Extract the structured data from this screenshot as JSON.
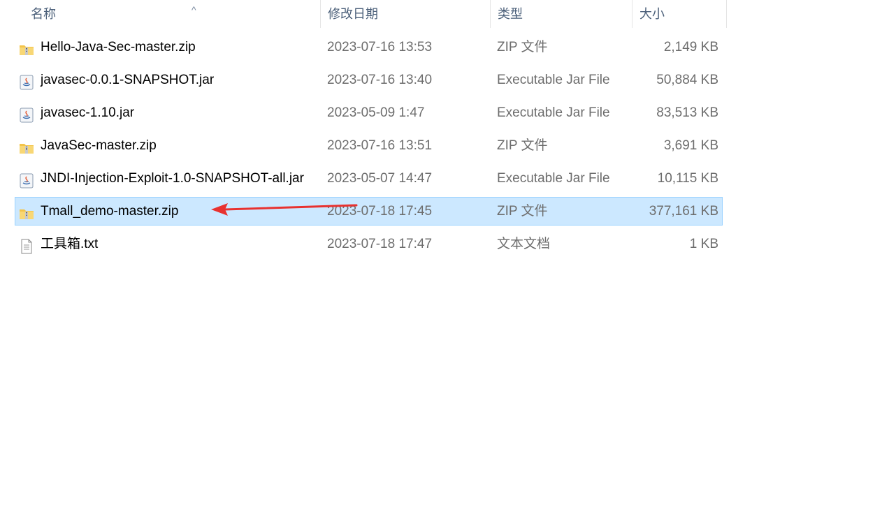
{
  "header": {
    "name_label": "名称",
    "date_label": "修改日期",
    "type_label": "类型",
    "size_label": "大小",
    "sort_indicator": "^"
  },
  "files": [
    {
      "name": "Hello-Java-Sec-master.zip",
      "date": "2023-07-16 13:53",
      "type": "ZIP 文件",
      "size": "2,149 KB",
      "icon": "zip-folder-icon",
      "selected": false
    },
    {
      "name": "javasec-0.0.1-SNAPSHOT.jar",
      "date": "2023-07-16 13:40",
      "type": "Executable Jar File",
      "size": "50,884 KB",
      "icon": "java-jar-icon",
      "selected": false
    },
    {
      "name": "javasec-1.10.jar",
      "date": "2023-05-09 1:47",
      "type": "Executable Jar File",
      "size": "83,513 KB",
      "icon": "java-jar-icon",
      "selected": false
    },
    {
      "name": "JavaSec-master.zip",
      "date": "2023-07-16 13:51",
      "type": "ZIP 文件",
      "size": "3,691 KB",
      "icon": "zip-folder-icon",
      "selected": false
    },
    {
      "name": "JNDI-Injection-Exploit-1.0-SNAPSHOT-all.jar",
      "date": "2023-05-07 14:47",
      "type": "Executable Jar File",
      "size": "10,115 KB",
      "icon": "java-jar-icon",
      "selected": false
    },
    {
      "name": "Tmall_demo-master.zip",
      "date": "2023-07-18 17:45",
      "type": "ZIP 文件",
      "size": "377,161 KB",
      "icon": "zip-folder-icon",
      "selected": true
    },
    {
      "name": "工具箱.txt",
      "date": "2023-07-18 17:47",
      "type": "文本文档",
      "size": "1 KB",
      "icon": "text-file-icon",
      "selected": false
    }
  ],
  "colors": {
    "selection_bg": "#cce8ff",
    "selection_border": "#99d1ff",
    "annotation_arrow": "#e8312f"
  }
}
